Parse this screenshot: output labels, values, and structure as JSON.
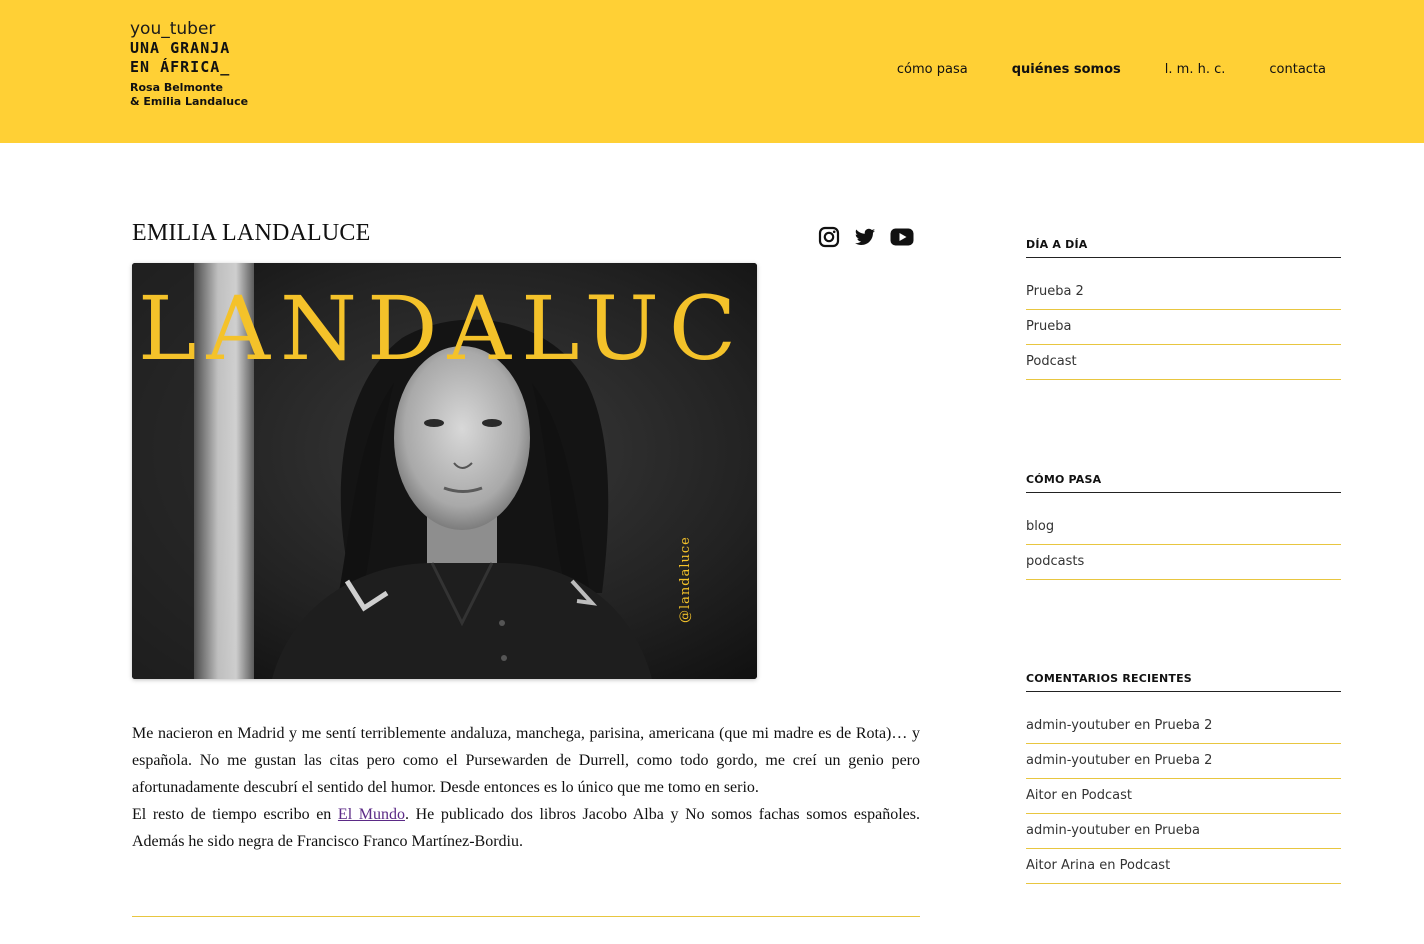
{
  "header": {
    "logo": {
      "line1": "you_tuber",
      "line2": "UNA GRANJA",
      "line3": "EN ÁFRICA_",
      "line4": "Rosa Belmonte",
      "line5": "& Emilia Landaluce"
    },
    "nav": [
      {
        "label": "cómo pasa",
        "active": false
      },
      {
        "label": "quiénes somos",
        "active": true
      },
      {
        "label": "l. m. h. c.",
        "active": false
      },
      {
        "label": "contacta",
        "active": false
      }
    ]
  },
  "main": {
    "title": "EMILIA LANDALUCE",
    "socials": [
      "instagram-icon",
      "twitter-icon",
      "youtube-icon"
    ],
    "hero": {
      "overlay_title": "LANDALUCE",
      "handle": "@landaluce"
    },
    "bio": {
      "p1": "Me nacieron en Madrid y me sentí terriblemente  andaluza, manchega, parisina, americana (que mi madre es de Rota)…  y española. No me gustan las citas pero como el Pursewarden de Durrell, como todo gordo, me creí un genio pero afortunadamente descubrí el sentido del humor. Desde entonces es lo único que me tomo en serio.",
      "p2_before": "El resto de tiempo escribo en ",
      "p2_link": "El Mundo",
      "p2_after": ". He publicado dos libros Jacobo Alba y No somos fachas somos españoles. Además he sido negra de Francisco Franco Martínez-Bordiu."
    }
  },
  "sidebar": {
    "widgets": [
      {
        "title": "DÍA A DÍA",
        "items": [
          "Prueba 2",
          "Prueba",
          "Podcast"
        ]
      },
      {
        "title": "CÓMO PASA",
        "items": [
          "blog",
          "podcasts"
        ]
      },
      {
        "title": "COMENTARIOS RECIENTES",
        "items": [
          {
            "author": "admin-youtuber",
            "sep": " en ",
            "post": "Prueba 2"
          },
          {
            "author": "admin-youtuber",
            "sep": " en ",
            "post": "Prueba 2"
          },
          {
            "author": "Aitor",
            "sep": " en ",
            "post": "Podcast"
          },
          {
            "author": "admin-youtuber",
            "sep": " en ",
            "post": "Prueba"
          },
          {
            "author": "Aitor Arina",
            "sep": " en ",
            "post": "Podcast"
          }
        ]
      }
    ]
  },
  "colors": {
    "brand_yellow": "#ffd035",
    "divider_yellow": "#e8c640",
    "link_purple": "#5b2a86"
  }
}
